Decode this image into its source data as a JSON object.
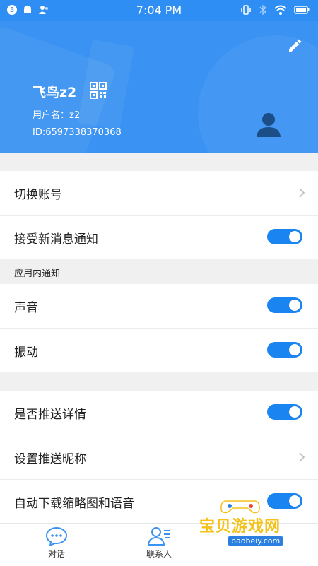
{
  "status_bar": {
    "time": "7:04 PM",
    "notification_count": "3"
  },
  "header": {
    "name": "飞鸟z2",
    "username_line": "用户名：z2",
    "id_line": "ID:6597338370368"
  },
  "settings": {
    "switch_account": "切换账号",
    "receive_notifications": "接受新消息通知",
    "in_app_section": "应用内通知",
    "sound": "声音",
    "vibration": "振动",
    "push_details": "是否推送详情",
    "set_push_nickname": "设置推送昵称",
    "auto_download": "自动下载缩略图和语音"
  },
  "toggles": {
    "receive_notifications": true,
    "sound": true,
    "vibration": true,
    "push_details": true,
    "auto_download": true
  },
  "nav": {
    "chat": "对话",
    "contacts": "联系人"
  },
  "watermark": {
    "text": "宝贝游戏网",
    "url": "baobeiy.com"
  },
  "colors": {
    "primary": "#2e8ef4",
    "toggle_on": "#1a84f0"
  }
}
